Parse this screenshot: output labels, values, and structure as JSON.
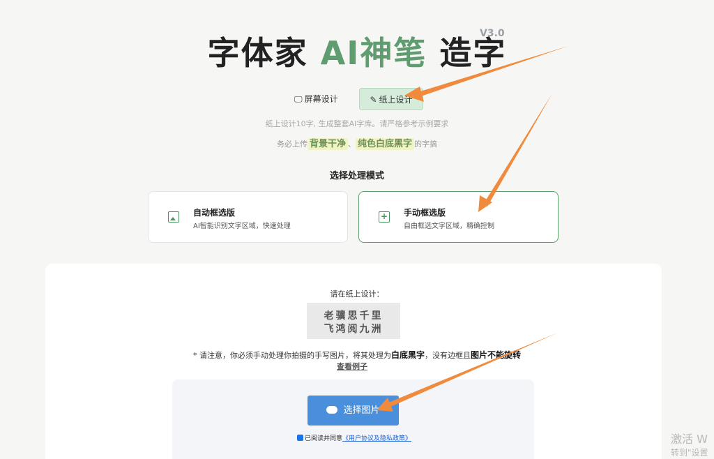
{
  "title": {
    "part1": "字体家 ",
    "part2": "AI神笔",
    "part3": " 造字",
    "version": "V3.0"
  },
  "tabs": [
    {
      "label": "屏幕设计",
      "icon": "monitor-icon"
    },
    {
      "label": "纸上设计",
      "icon": "pencil-icon",
      "active": true
    }
  ],
  "intro": {
    "line1": "纸上设计10字, 生成整套AI字库。请严格参考示例要求",
    "line2_pre": "务必上传",
    "highlight1": "背景干净",
    "sep": "、",
    "highlight2": "纯色白底黑字",
    "line2_post": "的字搞"
  },
  "mode_section": {
    "title": "选择处理模式",
    "cards": [
      {
        "title": "自动框选版",
        "sub": "AI智能识别文字区域，快速处理",
        "icon": "image-icon"
      },
      {
        "title": "手动框选版",
        "sub": "自由框选文字区域，精确控制",
        "icon": "plus-square-icon",
        "selected": true
      }
    ]
  },
  "panel": {
    "label": "请在纸上设计：",
    "chars_row1": "老骥思千里",
    "chars_row2": "飞鸿阅九洲",
    "notice_pre": "* 请注意，你必须手动处理你拍摄的手写图片，将其处理为",
    "notice_bold1": "白底黑字",
    "notice_mid": "，没有边框且",
    "notice_bold2": "图片不能旋转",
    "example_link": "查看例子",
    "upload_label": "选择图片",
    "agree_text": "已阅读并同意",
    "agree_link": "《用户协议及隐私政策》"
  },
  "watermark": {
    "line1": "激活 W",
    "line2": "转到\"设置"
  },
  "colors": {
    "accent_green": "#5f9c6f",
    "upload_blue": "#4a8fdc",
    "arrow_orange": "#f08a3c"
  }
}
